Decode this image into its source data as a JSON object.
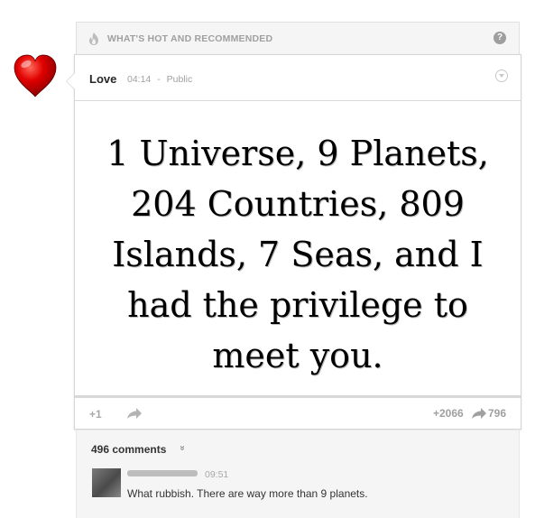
{
  "section": {
    "title": "WHAT'S HOT AND RECOMMENDED",
    "help_icon": "?",
    "colors": {
      "bar_bg": "#f5f5f5",
      "bar_text": "#a0a0a0"
    }
  },
  "post": {
    "author": "Love",
    "time": "04:14",
    "separator": "-",
    "visibility": "Public",
    "quote": "1 Universe, 9 Planets, 204 Countries, 809 Islands, 7 Seas, and I had the privilege to meet you.",
    "quote_lines": [
      "1 Universe, 9 Planets,",
      "204 Countries, 809",
      "Islands, 7 Seas, and I",
      "had the privilege to",
      "meet you."
    ],
    "heart_color": "#d40000"
  },
  "actions": {
    "plus_one": "+1",
    "plus_count": "+2066",
    "share_count": "796"
  },
  "comments": {
    "count_label": "496 comments",
    "toggle": "»",
    "items": [
      {
        "time": "09:51",
        "text": "What rubbish. There are way more than 9 planets."
      }
    ]
  }
}
